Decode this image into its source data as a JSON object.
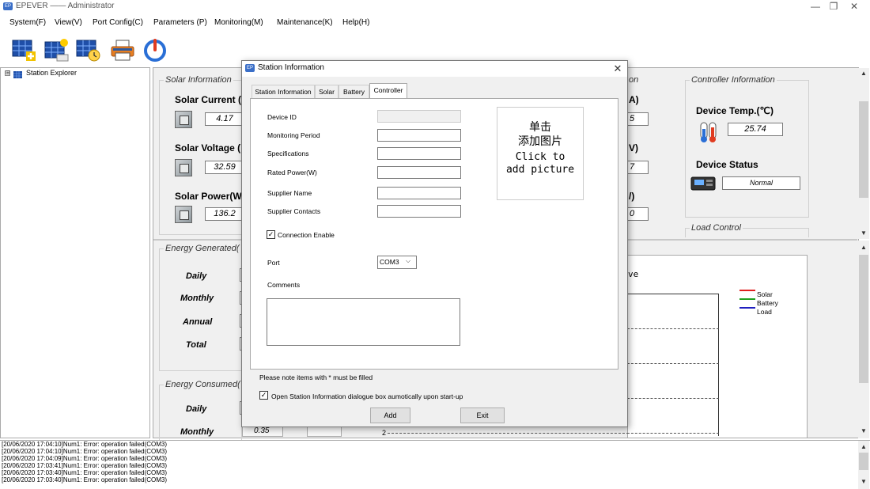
{
  "window": {
    "title": "EPEVER —— Administrator",
    "app_icon": "EP",
    "minimize": "—",
    "restore": "❐",
    "close": "✕"
  },
  "menu": [
    "System(F)",
    "View(V)",
    "Port Config(C)",
    "Parameters (P)",
    "Monitoring(M)",
    "Maintenance(K)",
    "Help(H)"
  ],
  "toolbar": [
    "add-station-icon",
    "solar-panel-icon",
    "clock-panel-icon",
    "printer-icon",
    "power-icon"
  ],
  "explorer": {
    "toggle": "⊞",
    "label": "Station Explorer"
  },
  "solar": {
    "group_label": "Solar Information",
    "current_label": "Solar Current (",
    "current_value": "4.17",
    "voltage_label": "Solar Voltage (",
    "voltage_value": "32.59",
    "power_label": "Solar Power(W",
    "power_value": "136.2"
  },
  "mid_partial": {
    "header": "on",
    "row1_label": "A)",
    "row1_value": "5",
    "row2_label": "V)",
    "row2_value": "7",
    "row3_label": "/)",
    "row3_value": "0"
  },
  "controller": {
    "group_label": "Controller Information",
    "temp_label": "Device Temp.(℃)",
    "temp_value": "25.74",
    "status_label": "Device Status",
    "status_value": "Normal",
    "load_control_label": "Load Control"
  },
  "energy_generated": {
    "group_label": "Energy Generated(",
    "rows": [
      "Daily",
      "Monthly",
      "Annual",
      "Total"
    ]
  },
  "energy_consumed": {
    "group_label": "Energy Consumed(",
    "rows": [
      "Daily",
      "Monthly"
    ],
    "monthly_value": "0.35"
  },
  "curve": {
    "title_partial": "ve",
    "legend": [
      {
        "name": "Solar",
        "color": "#e02020"
      },
      {
        "name": "Battery",
        "color": "#20a020"
      },
      {
        "name": "Load",
        "color": "#2020c0"
      }
    ],
    "axis_tick": "2"
  },
  "log": [
    "[20/06/2020 17:04:10]Num1: Error: operation failed(COM3)",
    "[20/06/2020 17:04:10]Num1: Error: operation failed(COM3)",
    "[20/06/2020 17:04:09]Num1: Error: operation failed(COM3)",
    "[20/06/2020 17:03:41]Num1: Error: operation failed(COM3)",
    "[20/06/2020 17:03:40]Num1: Error: operation failed(COM3)",
    "[20/06/2020 17:03:40]Num1: Error: operation failed(COM3)"
  ],
  "dialog": {
    "title": "Station Information",
    "close": "✕",
    "tabs": [
      "Station Information",
      "Solar",
      "Battery",
      "Controller"
    ],
    "active_tab": "Controller",
    "fields": [
      {
        "label": "Device ID",
        "value": ""
      },
      {
        "label": "Monitoring Period",
        "value": ""
      },
      {
        "label": "Specifications",
        "value": ""
      },
      {
        "label": "Rated Power(W)",
        "value": ""
      },
      {
        "label": "Supplier Name",
        "value": ""
      },
      {
        "label": "Supplier Contacts",
        "value": ""
      }
    ],
    "picture_text": [
      "单击",
      "添加图片",
      "Click to",
      "add picture"
    ],
    "connection_enable_label": "Connection Enable",
    "connection_enable_checked": true,
    "port_label": "Port",
    "port_value": "COM3",
    "comments_label": "Comments",
    "comments_value": "",
    "note": "Please note items with * must be filled",
    "auto_open_label": "Open Station Information dialogue box aumotically upon start-up",
    "auto_open_checked": true,
    "add_button": "Add",
    "exit_button": "Exit"
  }
}
